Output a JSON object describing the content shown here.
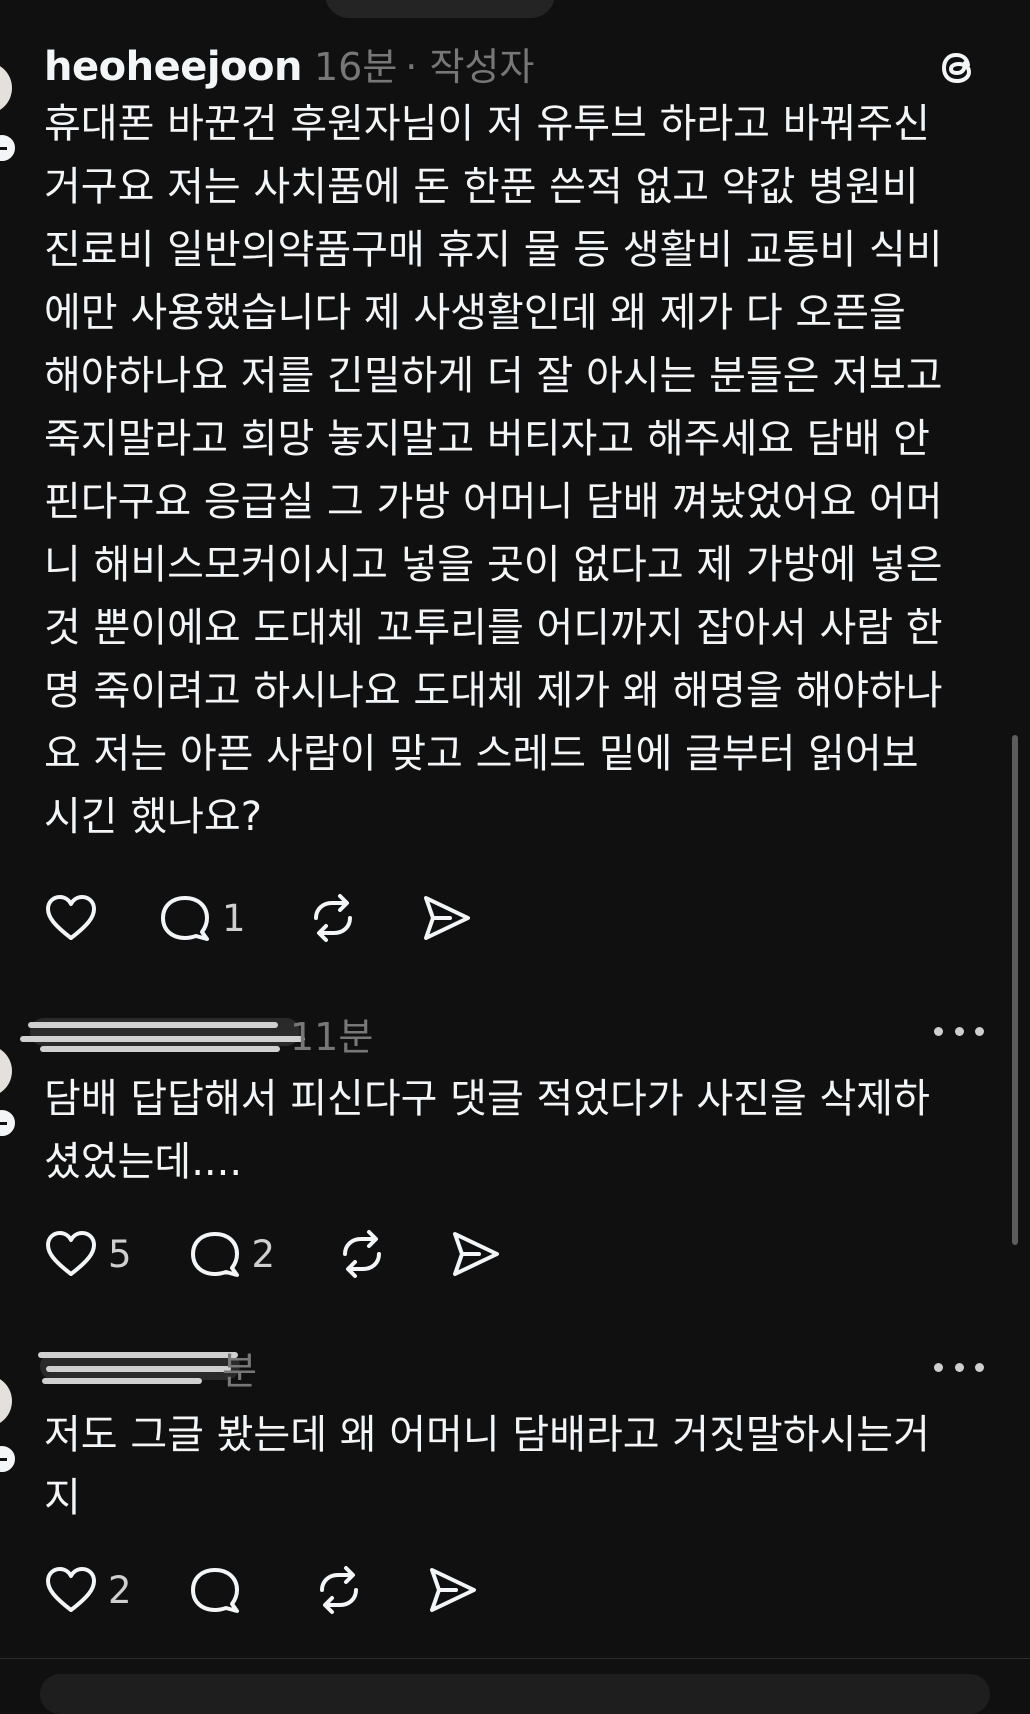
{
  "post": {
    "username": "heoheejoon",
    "time": "16분",
    "author_tag": "· 작성자",
    "text": "휴대폰 바꾼건 후원자님이 저 유투브 하라고 바꿔주신\n거구요 저는 사치품에 돈 한푼 쓴적 없고 약값 병원비\n진료비 일반의약품구매 휴지 물 등 생활비 교통비 식비\n에만 사용했습니다 제 사생활인데 왜 제가 다 오픈을\n해야하나요 저를 긴밀하게 더 잘 아시는 분들은 저보고\n죽지말라고 희망 놓지말고 버티자고 해주세요 담배 안\n핀다구요 응급실 그 가방 어머니 담배 껴놨었어요 어머\n니 해비스모커이시고 넣을 곳이 없다고 제 가방에 넣은\n것 뿐이에요 도대체 꼬투리를 어디까지 잡아서 사람 한\n명 죽이려고 하시나요 도대체 제가 왜 해명을 해야하나\n요 저는 아픈 사람이 맞고 스레드 밑에 글부터 읽어보\n시긴 했나요?",
    "likes": "",
    "replies": "1"
  },
  "comments": [
    {
      "time": "11분",
      "text": "담배 답답해서 피신다구 댓글 적었다가 사진을 삭제하\n셨었는데....",
      "likes": "5",
      "replies": "2"
    },
    {
      "time": "분",
      "text": "저도 그글 봤는데 왜 어머니 담배라고 거짓말하시는거\n지",
      "likes": "2",
      "replies": ""
    }
  ],
  "icons": {
    "like": "heart-icon",
    "reply": "comment-bubble-icon",
    "repost": "repost-icon",
    "share": "share-send-icon",
    "brand": "threads-logo",
    "more": "more-options-icon"
  },
  "colors": {
    "background": "#101010",
    "text": "#f3f5f7",
    "secondary": "#777777"
  }
}
